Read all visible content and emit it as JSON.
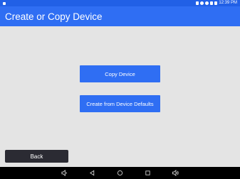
{
  "status_bar": {
    "time": "12:39 PM",
    "icons": [
      "bluetooth-icon",
      "alarm-icon",
      "wifi-icon",
      "signal-icon",
      "battery-icon"
    ]
  },
  "app_bar": {
    "title": "Create or Copy Device"
  },
  "actions": {
    "copy_device_label": "Copy Device",
    "create_defaults_label": "Create from Device Defaults"
  },
  "footer": {
    "back_label": "Back"
  },
  "nav_bar": {
    "icons": [
      "volume-down-icon",
      "back-triangle-icon",
      "home-circle-icon",
      "recents-square-icon",
      "volume-up-icon"
    ]
  },
  "colors": {
    "primary": "#2f6ef3",
    "status_bar": "#2160e6",
    "background": "#e4e4e4",
    "back_button": "#2b2b33"
  }
}
